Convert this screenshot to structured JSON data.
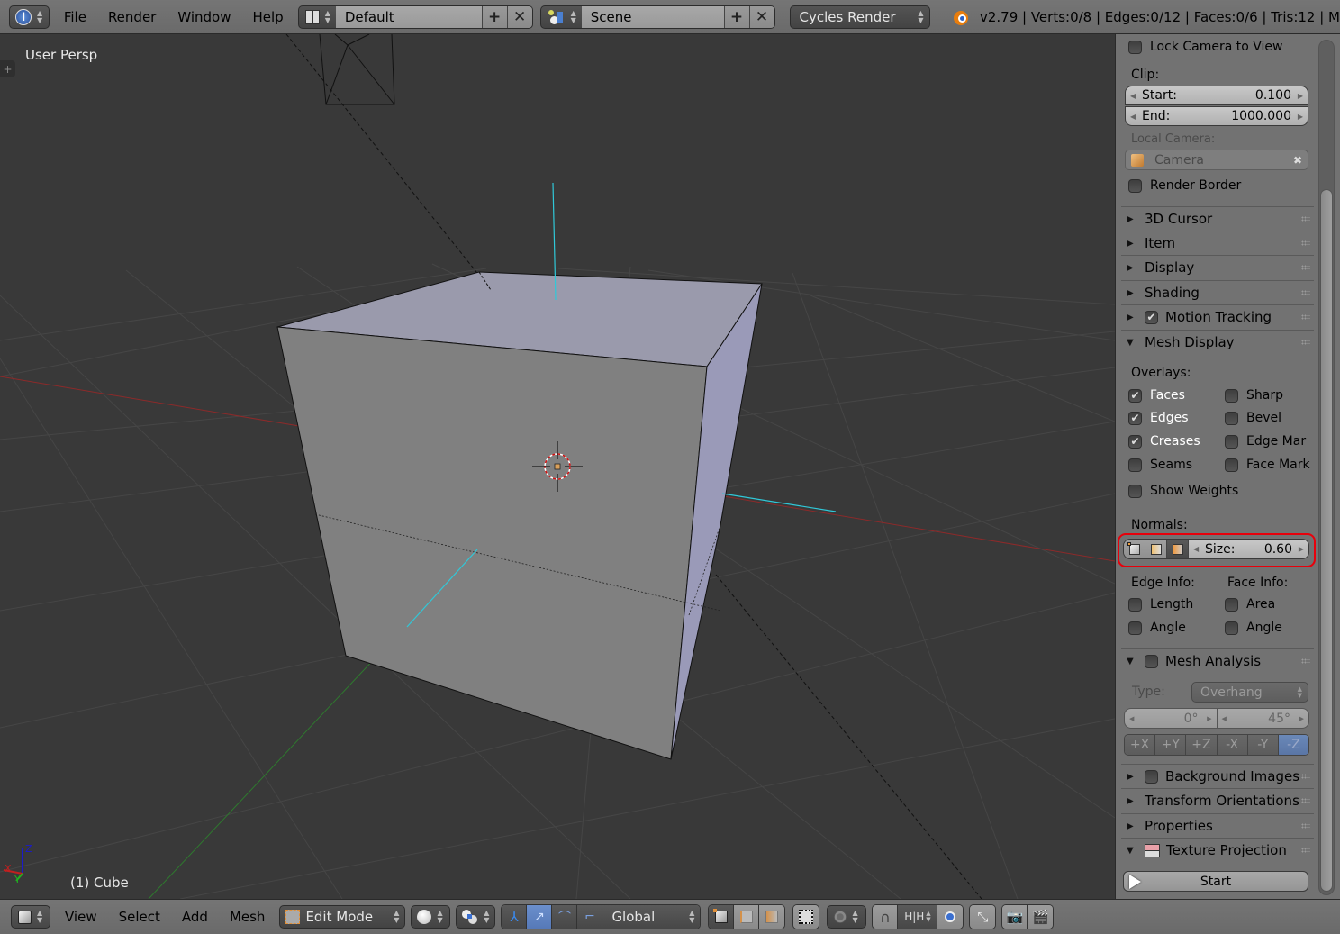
{
  "topbar": {
    "info_icon": "info-icon",
    "menus": [
      "File",
      "Render",
      "Window",
      "Help"
    ],
    "layout": {
      "value": "Default",
      "icon": "screen-layout-icon"
    },
    "scene": {
      "value": "Scene",
      "icon": "scene-icon"
    },
    "render_engine": "Cycles Render",
    "stats": "v2.79 | Verts:0/8 | Edges:0/12 | Faces:0/6 | Tris:12 | M"
  },
  "viewport": {
    "view_label": "User Persp",
    "object_label": "(1) Cube",
    "axis_labels": {
      "x": "X",
      "y": "Y",
      "z": "Z"
    }
  },
  "panel": {
    "lock_camera": {
      "label": "Lock Camera to View",
      "checked": false
    },
    "clip": {
      "label": "Clip:",
      "start": {
        "label": "Start:",
        "value": "0.100"
      },
      "end": {
        "label": "End:",
        "value": "1000.000"
      }
    },
    "local_camera": {
      "label": "Local Camera:",
      "value": "Camera"
    },
    "render_border": {
      "label": "Render Border",
      "checked": false
    },
    "sections": {
      "cursor": "3D Cursor",
      "item": "Item",
      "display": "Display",
      "shading": "Shading",
      "motion_tracking": "Motion Tracking",
      "mesh_display": "Mesh Display",
      "mesh_analysis": "Mesh Analysis",
      "background_images": "Background Images",
      "transform_orientations": "Transform Orientations",
      "properties": "Properties",
      "texture_projection": "Texture Projection"
    },
    "overlays": {
      "label": "Overlays:",
      "left": [
        {
          "label": "Faces",
          "checked": true
        },
        {
          "label": "Edges",
          "checked": true
        },
        {
          "label": "Creases",
          "checked": true
        },
        {
          "label": "Seams",
          "checked": false
        }
      ],
      "right": [
        {
          "label": "Sharp",
          "checked": false
        },
        {
          "label": "Bevel",
          "checked": false
        },
        {
          "label": "Edge Mar",
          "checked": false
        },
        {
          "label": "Face Mark",
          "checked": false
        }
      ],
      "show_weights": {
        "label": "Show Weights",
        "checked": false
      }
    },
    "normals": {
      "label": "Normals:",
      "size_label": "Size:",
      "size_value": "0.60",
      "highlight_color": "#e8000b"
    },
    "edge_info": {
      "label": "Edge Info:",
      "items": [
        {
          "label": "Length",
          "checked": false
        },
        {
          "label": "Angle",
          "checked": false
        }
      ]
    },
    "face_info": {
      "label": "Face Info:",
      "items": [
        {
          "label": "Area",
          "checked": false
        },
        {
          "label": "Angle",
          "checked": false
        }
      ]
    },
    "mesh_analysis": {
      "type_label": "Type:",
      "type_value": "Overhang",
      "min": "0°",
      "max": "45°",
      "axes": [
        "+X",
        "+Y",
        "+Z",
        "-X",
        "-Y",
        "-Z"
      ],
      "active_axis": "-Z"
    },
    "texture_projection": {
      "start_label": "Start"
    }
  },
  "bottombar": {
    "menus": [
      "View",
      "Select",
      "Add",
      "Mesh"
    ],
    "mode": "Edit Mode",
    "orientation": "Global"
  },
  "colors": {
    "accent": "#5679b8",
    "viewport_bg": "#393939",
    "panel_bg": "#727272",
    "x_axis": "#b33030",
    "y_axis": "#2e8a2e",
    "normal_line": "#30d0e0"
  }
}
